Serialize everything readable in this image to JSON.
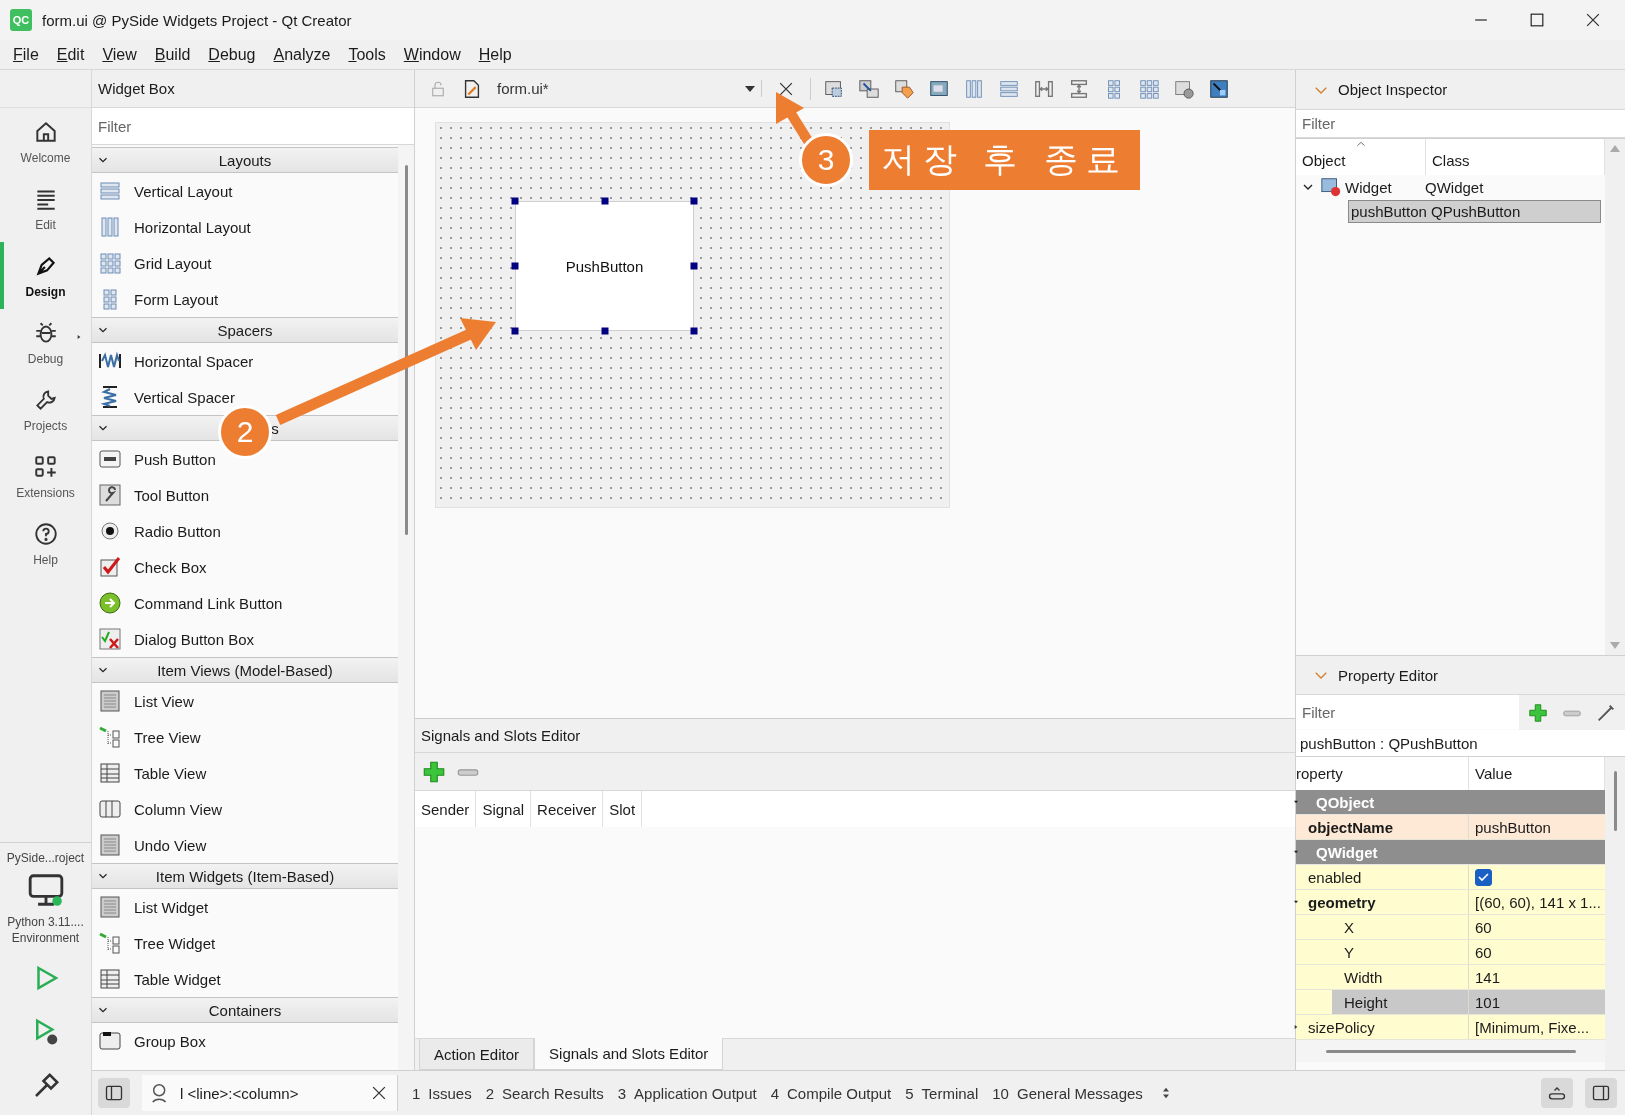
{
  "window": {
    "logo": "QC",
    "title": "form.ui @ PySide Widgets Project - Qt Creator"
  },
  "menu": [
    "File",
    "Edit",
    "View",
    "Build",
    "Debug",
    "Analyze",
    "Tools",
    "Window",
    "Help"
  ],
  "mode_bar": {
    "items": [
      {
        "label": "Welcome",
        "selected": false
      },
      {
        "label": "Edit",
        "selected": false
      },
      {
        "label": "Design",
        "selected": true
      },
      {
        "label": "Debug",
        "selected": false
      },
      {
        "label": "Projects",
        "selected": false
      },
      {
        "label": "Extensions",
        "selected": false
      },
      {
        "label": "Help",
        "selected": false
      }
    ],
    "project": "PySide...roject",
    "kit": [
      "Python 3.11....",
      "Environment"
    ]
  },
  "widget_box": {
    "title": "Widget Box",
    "filter_placeholder": "Filter",
    "categories": [
      {
        "label": "Layouts",
        "expanded": true,
        "items": [
          "Vertical Layout",
          "Horizontal Layout",
          "Grid Layout",
          "Form Layout"
        ]
      },
      {
        "label": "Spacers",
        "expanded": true,
        "items": [
          "Horizontal Spacer",
          "Vertical Spacer"
        ]
      },
      {
        "label": "s",
        "expanded": true,
        "items": [
          "Push Button",
          "Tool Button",
          "Radio Button",
          "Check Box",
          "Command Link Button",
          "Dialog Button Box"
        ]
      },
      {
        "label": "Item Views (Model-Based)",
        "expanded": true,
        "items": [
          "List View",
          "Tree View",
          "Table View",
          "Column View",
          "Undo View"
        ]
      },
      {
        "label": "Item Widgets (Item-Based)",
        "expanded": true,
        "items": [
          "List Widget",
          "Tree Widget",
          "Table Widget"
        ]
      },
      {
        "label": "Containers",
        "expanded": true,
        "items": [
          "Group Box"
        ]
      }
    ]
  },
  "editor": {
    "file": "form.ui*",
    "form": {
      "button": "PushButton"
    }
  },
  "signals_slots": {
    "title": "Signals and Slots Editor",
    "columns": [
      "Sender",
      "Signal",
      "Receiver",
      "Slot"
    ],
    "tabs": [
      {
        "label": "Action Editor",
        "selected": false
      },
      {
        "label": "Signals and Slots Editor",
        "selected": true
      }
    ]
  },
  "object_inspector": {
    "title": "Object Inspector",
    "filter_placeholder": "Filter",
    "columns": [
      "Object",
      "Class"
    ],
    "tree": [
      {
        "object": "Widget",
        "class": "QWidget",
        "selected": false,
        "expanded": true,
        "children": [
          {
            "object": "pushButton",
            "class": "QPushButton",
            "selected": true
          }
        ]
      }
    ]
  },
  "property_editor": {
    "title": "Property Editor",
    "filter_placeholder": "Filter",
    "object_line": "pushButton : QPushButton",
    "columns": [
      "roperty",
      "Value"
    ],
    "groups": [
      {
        "name": "QObject",
        "expanded": true,
        "color": "#fde9d6",
        "properties": [
          {
            "name": "objectName",
            "value": "pushButton",
            "bold": true,
            "selected": false
          }
        ]
      },
      {
        "name": "QWidget",
        "expanded": true,
        "color": "#fffdcf",
        "properties": [
          {
            "name": "enabled",
            "kind": "checkbox",
            "checked": true,
            "bold": false,
            "selected": false
          },
          {
            "name": "geometry",
            "value": "[(60, 60), 141 x 1...",
            "bold": true,
            "selected": false,
            "expanded": true,
            "children": [
              {
                "name": "X",
                "value": "60",
                "selected": false
              },
              {
                "name": "Y",
                "value": "60",
                "selected": false
              },
              {
                "name": "Width",
                "value": "141",
                "selected": false
              },
              {
                "name": "Height",
                "value": "101",
                "selected": true
              }
            ]
          },
          {
            "name": "sizePolicy",
            "value": "[Minimum, Fixe...",
            "bold": false,
            "selected": false,
            "expanded": false
          }
        ]
      }
    ]
  },
  "status_bar": {
    "locator": "l <line>:<column>",
    "panes": [
      {
        "number": "1",
        "label": "Issues"
      },
      {
        "number": "2",
        "label": "Search Results"
      },
      {
        "number": "3",
        "label": "Application Output"
      },
      {
        "number": "4",
        "label": "Compile Output"
      },
      {
        "number": "5",
        "label": "Terminal"
      },
      {
        "number": "10",
        "label": "General Messages"
      }
    ]
  },
  "annotations": [
    {
      "number": "2"
    },
    {
      "number": "3",
      "label": "저장 후 종료"
    }
  ]
}
